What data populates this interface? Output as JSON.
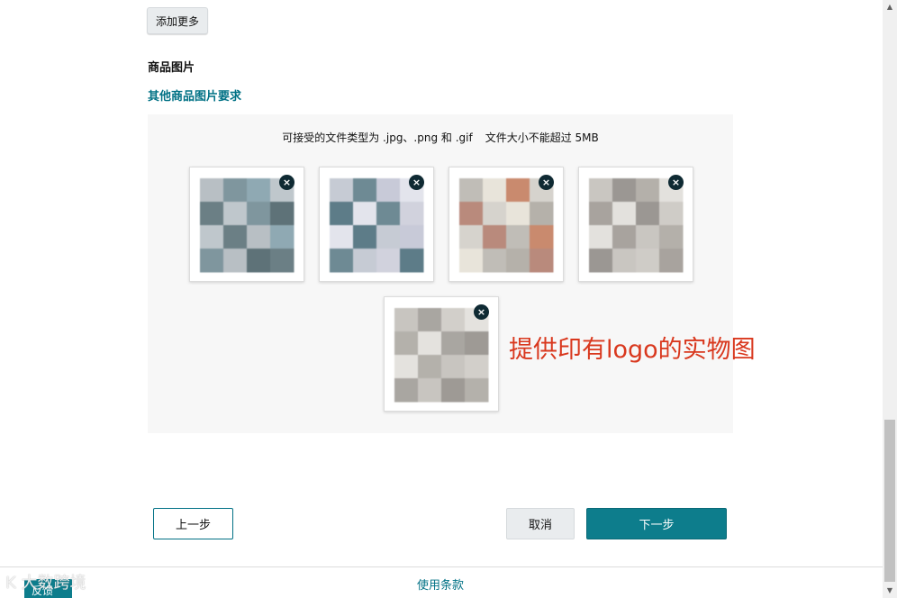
{
  "toolbar": {
    "add_more_label": "添加更多"
  },
  "images_section": {
    "title": "商品图片",
    "requirements_link": "其他商品图片要求",
    "hint": {
      "types": "可接受的文件类型为 .jpg、.png 和 .gif",
      "size": "文件大小不能超过 5MB"
    },
    "remove_icon_glyph": "×",
    "thumbnails": [
      {
        "name": "product-image-1",
        "colors": [
          "#b8bfc4",
          "#a9b4b8",
          "#7f969e",
          "#6b7f85",
          "#8fa9b3",
          "#5e7278",
          "#bfc7cc"
        ]
      },
      {
        "name": "product-image-2",
        "colors": [
          "#c6cbd4",
          "#b0b9c2",
          "#6e8a94",
          "#5d7c88",
          "#c8cad8",
          "#d1d2dd",
          "#e3e4ec"
        ]
      },
      {
        "name": "product-image-3",
        "colors": [
          "#c0bdb7",
          "#a9a6a0",
          "#e8e4da",
          "#b98a7c",
          "#c98a6e",
          "#b5b1aa",
          "#d6d3cd"
        ]
      },
      {
        "name": "product-image-4",
        "colors": [
          "#c9c6c1",
          "#bdbab5",
          "#9b9793",
          "#a8a39e",
          "#b4b0aa",
          "#cfccc7",
          "#e3e1dd"
        ]
      },
      {
        "name": "product-image-5",
        "colors": [
          "#c8c5c0",
          "#bcb9b4",
          "#a9a6a1",
          "#b4b1ab",
          "#d2cfca",
          "#9e9a95",
          "#e4e2de"
        ]
      }
    ]
  },
  "annotation": {
    "text": "提供印有logo的实物图",
    "color": "#d9381e"
  },
  "actions": {
    "prev_label": "上一步",
    "cancel_label": "取消",
    "next_label": "下一步"
  },
  "footer": {
    "terms_link": "使用条款",
    "feedback_label": "反馈",
    "watermark": "K 大数跨境"
  },
  "colors": {
    "accent": "#007185",
    "primary_button": "#0d7d8c",
    "panel_bg": "#f7f7f7"
  }
}
